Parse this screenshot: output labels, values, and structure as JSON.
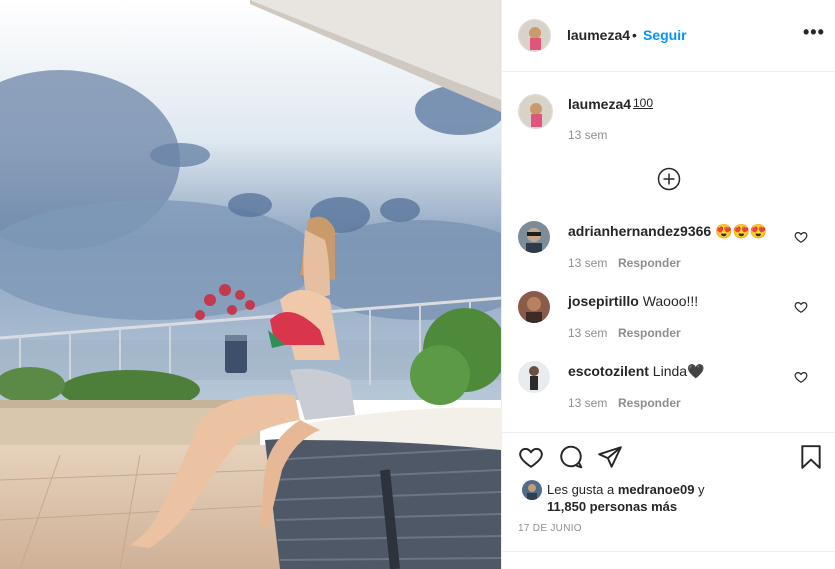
{
  "post": {
    "photo_icon": "post-photo-image"
  },
  "header": {
    "username": "laumeza4",
    "separator": "•",
    "follow_label": "Seguir",
    "more_label": "•••"
  },
  "caption": {
    "username": "laumeza4",
    "text": "100",
    "time": "13 sem",
    "load_more_icon": "plus-circle-icon"
  },
  "comments": [
    {
      "username": "adrianhernandez9366",
      "text": "😍😍😍",
      "time": "13 sem",
      "reply_label": "Responder"
    },
    {
      "username": "josepirtillo",
      "text": "Waooo!!!",
      "time": "13 sem",
      "reply_label": "Responder"
    },
    {
      "username": "escotozilent",
      "text": "Linda🖤",
      "time": "13 sem",
      "reply_label": "Responder"
    }
  ],
  "actions": {
    "like_icon": "heart-icon",
    "comment_icon": "comment-icon",
    "share_icon": "send-icon",
    "save_icon": "bookmark-icon"
  },
  "likes": {
    "prefix": "Les gusta a ",
    "user": "medranoe09",
    "connector": " y",
    "others": "11,850 personas más"
  },
  "date": "17 DE JUNIO",
  "colors": {
    "link": "#0095f6",
    "text": "#262626",
    "muted": "#8e8e8e",
    "border": "#efefef"
  }
}
